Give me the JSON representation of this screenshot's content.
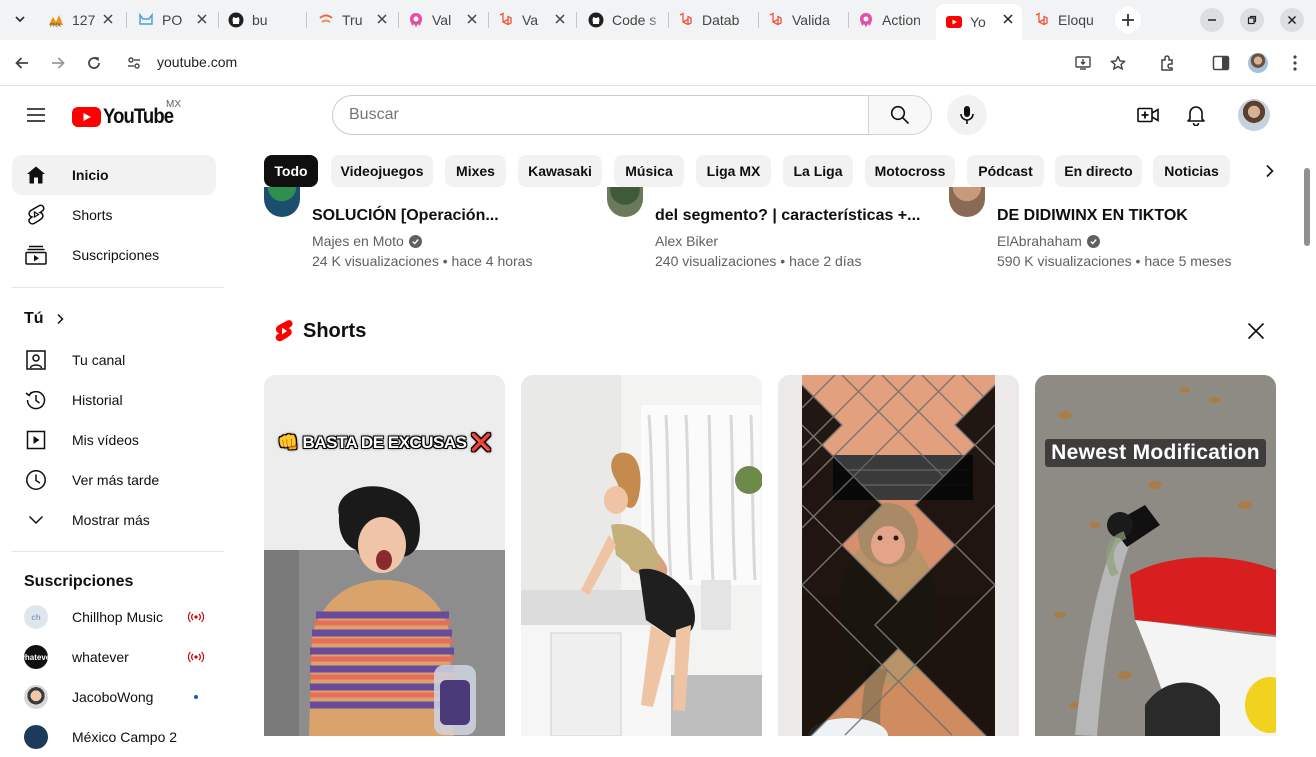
{
  "browser": {
    "tabs": [
      {
        "title": "127",
        "favicon": "pma-icon"
      },
      {
        "title": "PO",
        "favicon": "kitty-icon"
      },
      {
        "title": "bu",
        "favicon": "github-icon"
      },
      {
        "title": "Tru",
        "favicon": "trulia-icon"
      },
      {
        "title": "Val",
        "favicon": "hinchazon-icon"
      },
      {
        "title": "Va",
        "favicon": "laravel-icon"
      },
      {
        "title": "Code s",
        "favicon": "github-icon"
      },
      {
        "title": "Datab",
        "favicon": "laravel-icon"
      },
      {
        "title": "Valida",
        "favicon": "laravel-icon"
      },
      {
        "title": "Action",
        "favicon": "hinchazon-icon"
      },
      {
        "title": "Yo",
        "favicon": "youtube-icon",
        "active": true
      },
      {
        "title": "Eloqu",
        "favicon": "laravel-icon"
      }
    ],
    "url": "youtube.com"
  },
  "youtube": {
    "logo_text": "YouTube",
    "country_code": "MX",
    "search_placeholder": "Buscar"
  },
  "sidebar": {
    "main": [
      {
        "label": "Inicio",
        "icon": "home-icon",
        "active": true
      },
      {
        "label": "Shorts",
        "icon": "shorts-icon"
      },
      {
        "label": "Suscripciones",
        "icon": "subscriptions-icon"
      }
    ],
    "you_heading": "Tú",
    "you": [
      {
        "label": "Tu canal",
        "icon": "channel-icon"
      },
      {
        "label": "Historial",
        "icon": "history-icon"
      },
      {
        "label": "Mis vídeos",
        "icon": "my-videos-icon"
      },
      {
        "label": "Ver más tarde",
        "icon": "watch-later-icon"
      },
      {
        "label": "Mostrar más",
        "icon": "chevron-down-icon"
      }
    ],
    "subs_heading": "Suscripciones",
    "subscriptions": [
      {
        "name": "Chillhop Music",
        "status": "live"
      },
      {
        "name": "whatever",
        "status": "live"
      },
      {
        "name": "JacoboWong",
        "status": "new"
      },
      {
        "name": "México Campo 2",
        "status": ""
      }
    ]
  },
  "chips": [
    "Todo",
    "Videojuegos",
    "Mixes",
    "Kawasaki",
    "Música",
    "Liga MX",
    "La Liga",
    "Motocross",
    "Pódcast",
    "En directo",
    "Noticias"
  ],
  "videos": [
    {
      "title": "SOLUCIÓN [Operación...",
      "channel": "Majes en Moto",
      "verified": true,
      "meta": "24 K visualizaciones • hace 4 horas"
    },
    {
      "title": "del segmento? | características +...",
      "channel": "Alex Biker",
      "verified": false,
      "meta": "240 visualizaciones • hace 2 días"
    },
    {
      "title": "DE DIDIWINX EN TIKTOK",
      "channel": "ElAbrahaham",
      "verified": true,
      "meta": "590 K visualizaciones • hace 5 meses"
    }
  ],
  "shorts": {
    "heading": "Shorts",
    "items": [
      {
        "overlay": "👊 BASTA DE EXCUSAS ❌"
      },
      {
        "overlay": ""
      },
      {
        "overlay": ""
      },
      {
        "overlay": "Newest Modification"
      }
    ]
  },
  "colors": {
    "accent": "#ff0000",
    "chip_active": "#0f0f0f",
    "chip_bg": "#f2f2f2",
    "link_blue": "#065fd4"
  }
}
